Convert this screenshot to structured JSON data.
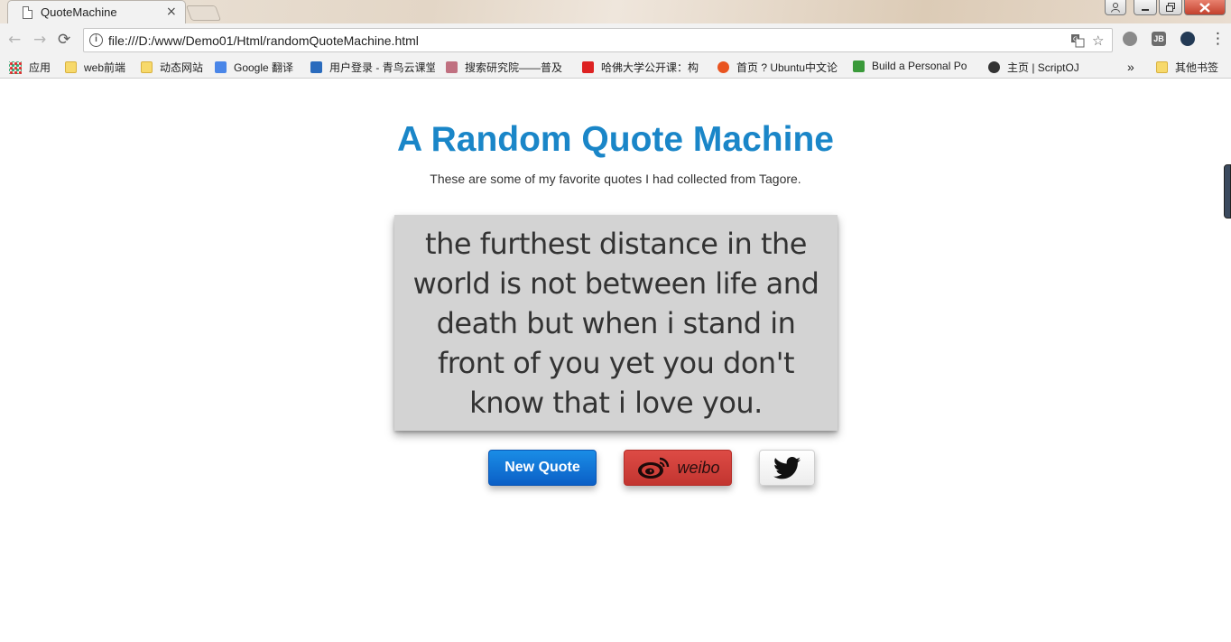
{
  "browser": {
    "tab_title": "QuoteMachine",
    "tab_close": "×",
    "url": "file:///D:/www/Demo01/Html/randomQuoteMachine.html",
    "nav": {
      "back": "←",
      "forward": "→",
      "reload": "⟳"
    },
    "menu_glyph": "⋮",
    "star_glyph": "☆",
    "bookmarks": [
      {
        "label": "应用",
        "icon": "apps-grid-icon"
      },
      {
        "label": "web前端",
        "icon": "folder-icon"
      },
      {
        "label": "动态网站",
        "icon": "folder-icon"
      },
      {
        "label": "Google 翻译",
        "icon": "google-translate-icon"
      },
      {
        "label": "用户登录 - 青鸟云课堂",
        "icon": "bird-icon"
      },
      {
        "label": "搜索研究院——普及",
        "icon": "bow-icon"
      },
      {
        "label": "哈佛大学公开课：构",
        "icon": "netease-icon"
      },
      {
        "label": "首页 ? Ubuntu中文论",
        "icon": "ubuntu-icon"
      },
      {
        "label": "Build a Personal Po",
        "icon": "freecodecamp-icon"
      },
      {
        "label": "主页 | ScriptOJ",
        "icon": "scriptoj-icon"
      }
    ],
    "overflow_chevron": "»",
    "other_bookmarks": "其他书签"
  },
  "page": {
    "title": "A Random Quote Machine",
    "subtitle": "These are some of my favorite quotes I had collected from Tagore.",
    "quote": "the furthest distance in the world is not between life and death but when i stand in front of you yet you don't know that i love you.",
    "buttons": {
      "new_quote": "New Quote",
      "weibo": "weibo"
    }
  },
  "colors": {
    "title": "#1a86c8",
    "card": "#d3d3d3",
    "new_quote_button": "#0b6fd6",
    "weibo_button": "#d0403a"
  }
}
